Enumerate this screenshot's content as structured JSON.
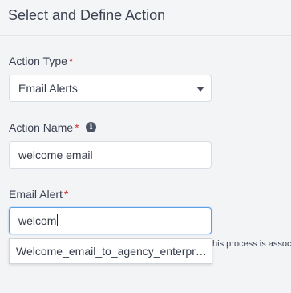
{
  "header": {
    "title": "Select and Define Action"
  },
  "action_type": {
    "label": "Action Type",
    "required_mark": "*",
    "value": "Email Alerts"
  },
  "action_name": {
    "label": "Action Name",
    "required_mark": "*",
    "value": "welcome email",
    "info_icon": "info-icon"
  },
  "email_alert": {
    "label": "Email Alert",
    "required_mark": "*",
    "value": "welcom",
    "suggestions": [
      "Welcome_email_to_agency_enterprise"
    ]
  },
  "background_text": "this process is associated",
  "colors": {
    "required": "#d0312d",
    "focus_border": "#5a9ee6",
    "text": "#3b4150",
    "background": "#f3f4f6"
  }
}
